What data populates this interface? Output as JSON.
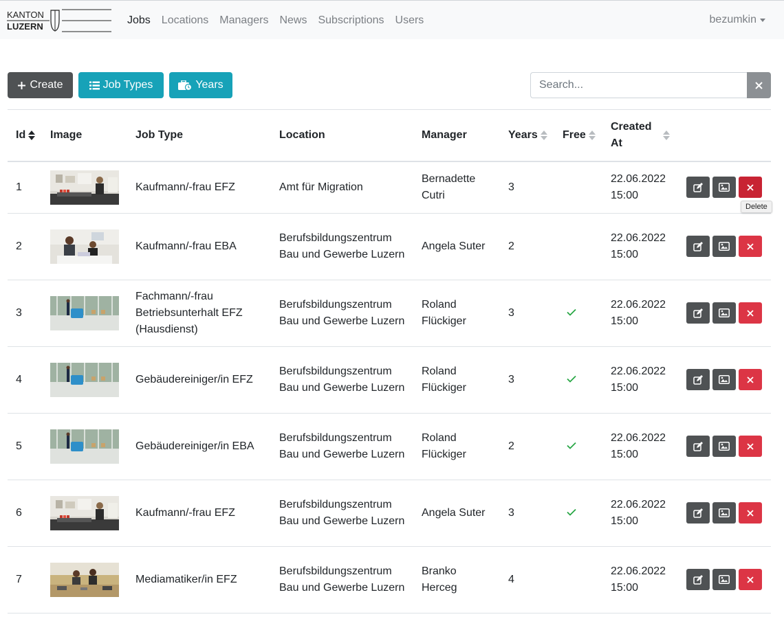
{
  "logo": {
    "line1": "KANTON",
    "line2": "LUZERN"
  },
  "nav": {
    "items": [
      {
        "label": "Jobs",
        "active": true
      },
      {
        "label": "Locations",
        "active": false
      },
      {
        "label": "Managers",
        "active": false
      },
      {
        "label": "News",
        "active": false
      },
      {
        "label": "Subscriptions",
        "active": false
      },
      {
        "label": "Users",
        "active": false
      }
    ],
    "user": "bezumkin"
  },
  "toolbar": {
    "create_label": "Create",
    "job_types_label": "Job Types",
    "years_label": "Years",
    "search_placeholder": "Search...",
    "search_value": ""
  },
  "table": {
    "headers": {
      "id": "Id",
      "image": "Image",
      "job_type": "Job Type",
      "location": "Location",
      "manager": "Manager",
      "years": "Years",
      "free": "Free",
      "created_at": "Created At"
    },
    "sort": {
      "column": "id",
      "direction": "asc"
    },
    "rows": [
      {
        "id": "1",
        "image": "office-woman",
        "job_type": "Kaufmann/-frau EFZ",
        "location": "Amt für Migration",
        "manager": "Bernadette Cutri",
        "years": "3",
        "free": false,
        "created_at": "22.06.2022 15:00"
      },
      {
        "id": "2",
        "image": "office-two-women",
        "job_type": "Kaufmann/-frau EBA",
        "location": "Berufsbildungszentrum Bau und Gewerbe Luzern",
        "manager": "Angela Suter",
        "years": "2",
        "free": false,
        "created_at": "22.06.2022 15:00"
      },
      {
        "id": "3",
        "image": "floor-cleaning",
        "job_type": "Fachmann/-frau Betriebsunterhalt EFZ (Hausdienst)",
        "location": "Berufsbildungszentrum Bau und Gewerbe Luzern",
        "manager": "Roland Flückiger",
        "years": "3",
        "free": true,
        "created_at": "22.06.2022 15:00"
      },
      {
        "id": "4",
        "image": "floor-cleaning",
        "job_type": "Gebäudereiniger/in EFZ",
        "location": "Berufsbildungszentrum Bau und Gewerbe Luzern",
        "manager": "Roland Flückiger",
        "years": "3",
        "free": true,
        "created_at": "22.06.2022 15:00"
      },
      {
        "id": "5",
        "image": "floor-cleaning",
        "job_type": "Gebäudereiniger/in EBA",
        "location": "Berufsbildungszentrum Bau und Gewerbe Luzern",
        "manager": "Roland Flückiger",
        "years": "2",
        "free": true,
        "created_at": "22.06.2022 15:00"
      },
      {
        "id": "6",
        "image": "office-woman",
        "job_type": "Kaufmann/-frau EFZ",
        "location": "Berufsbildungszentrum Bau und Gewerbe Luzern",
        "manager": "Angela Suter",
        "years": "3",
        "free": true,
        "created_at": "22.06.2022 15:00"
      },
      {
        "id": "7",
        "image": "media-workshop",
        "job_type": "Mediamatiker/in EFZ",
        "location": "Berufsbildungszentrum Bau und Gewerbe Luzern",
        "manager": "Branko Herceg",
        "years": "4",
        "free": false,
        "created_at": "22.06.2022 15:00"
      }
    ]
  },
  "tooltip": {
    "text": "Delete"
  },
  "colors": {
    "info": "#17a2b8",
    "secondary": "#4f5254",
    "danger": "#dc3545",
    "success": "#28a745"
  }
}
